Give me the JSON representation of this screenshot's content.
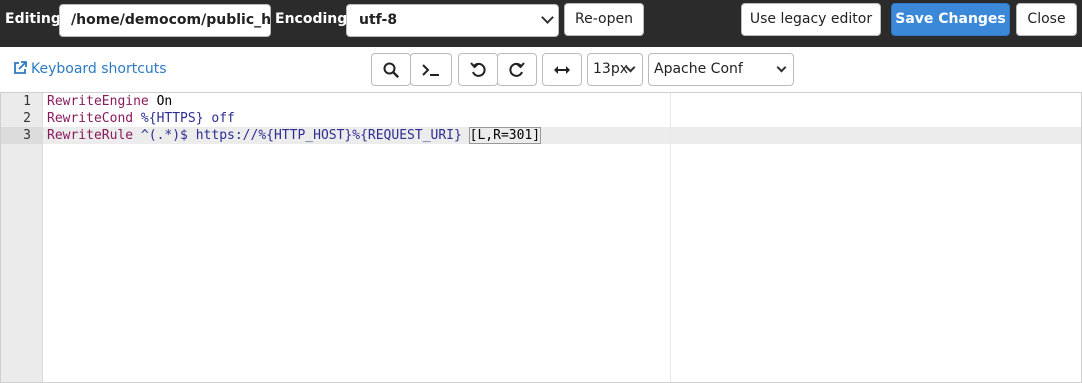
{
  "topbar": {
    "editing_label": "Editing:",
    "path_value": "/home/democom/public_h",
    "encoding_label": "Encoding:",
    "encoding_value": "utf-8",
    "reopen_label": "Re-open",
    "legacy_label": "Use legacy editor",
    "save_label": "Save Changes",
    "close_label": "Close"
  },
  "toolbar": {
    "shortcuts_label": "Keyboard shortcuts",
    "font_size": "13px",
    "mode": "Apache Conf",
    "icons": [
      "search-icon",
      "terminal-icon",
      "undo-icon",
      "redo-icon",
      "wrap-icon"
    ]
  },
  "editor": {
    "line_numbers": [
      "1",
      "2",
      "3"
    ],
    "lines": [
      {
        "directive": "RewriteEngine",
        "args": " On"
      },
      {
        "directive": "RewriteCond",
        "var": " %{HTTPS}",
        "args": " off"
      },
      {
        "directive": "RewriteRule",
        "pattern": " ^(.*)$",
        "target": " https://%{HTTP_HOST}%{REQUEST_URI}",
        "flags": "[L,R=301]"
      }
    ]
  },
  "colors": {
    "topbar": "#2b2b2b",
    "save_button": "#3b88d8",
    "link": "#2e7ac2",
    "directive": "#891b5d",
    "variable": "#2d2d94"
  }
}
